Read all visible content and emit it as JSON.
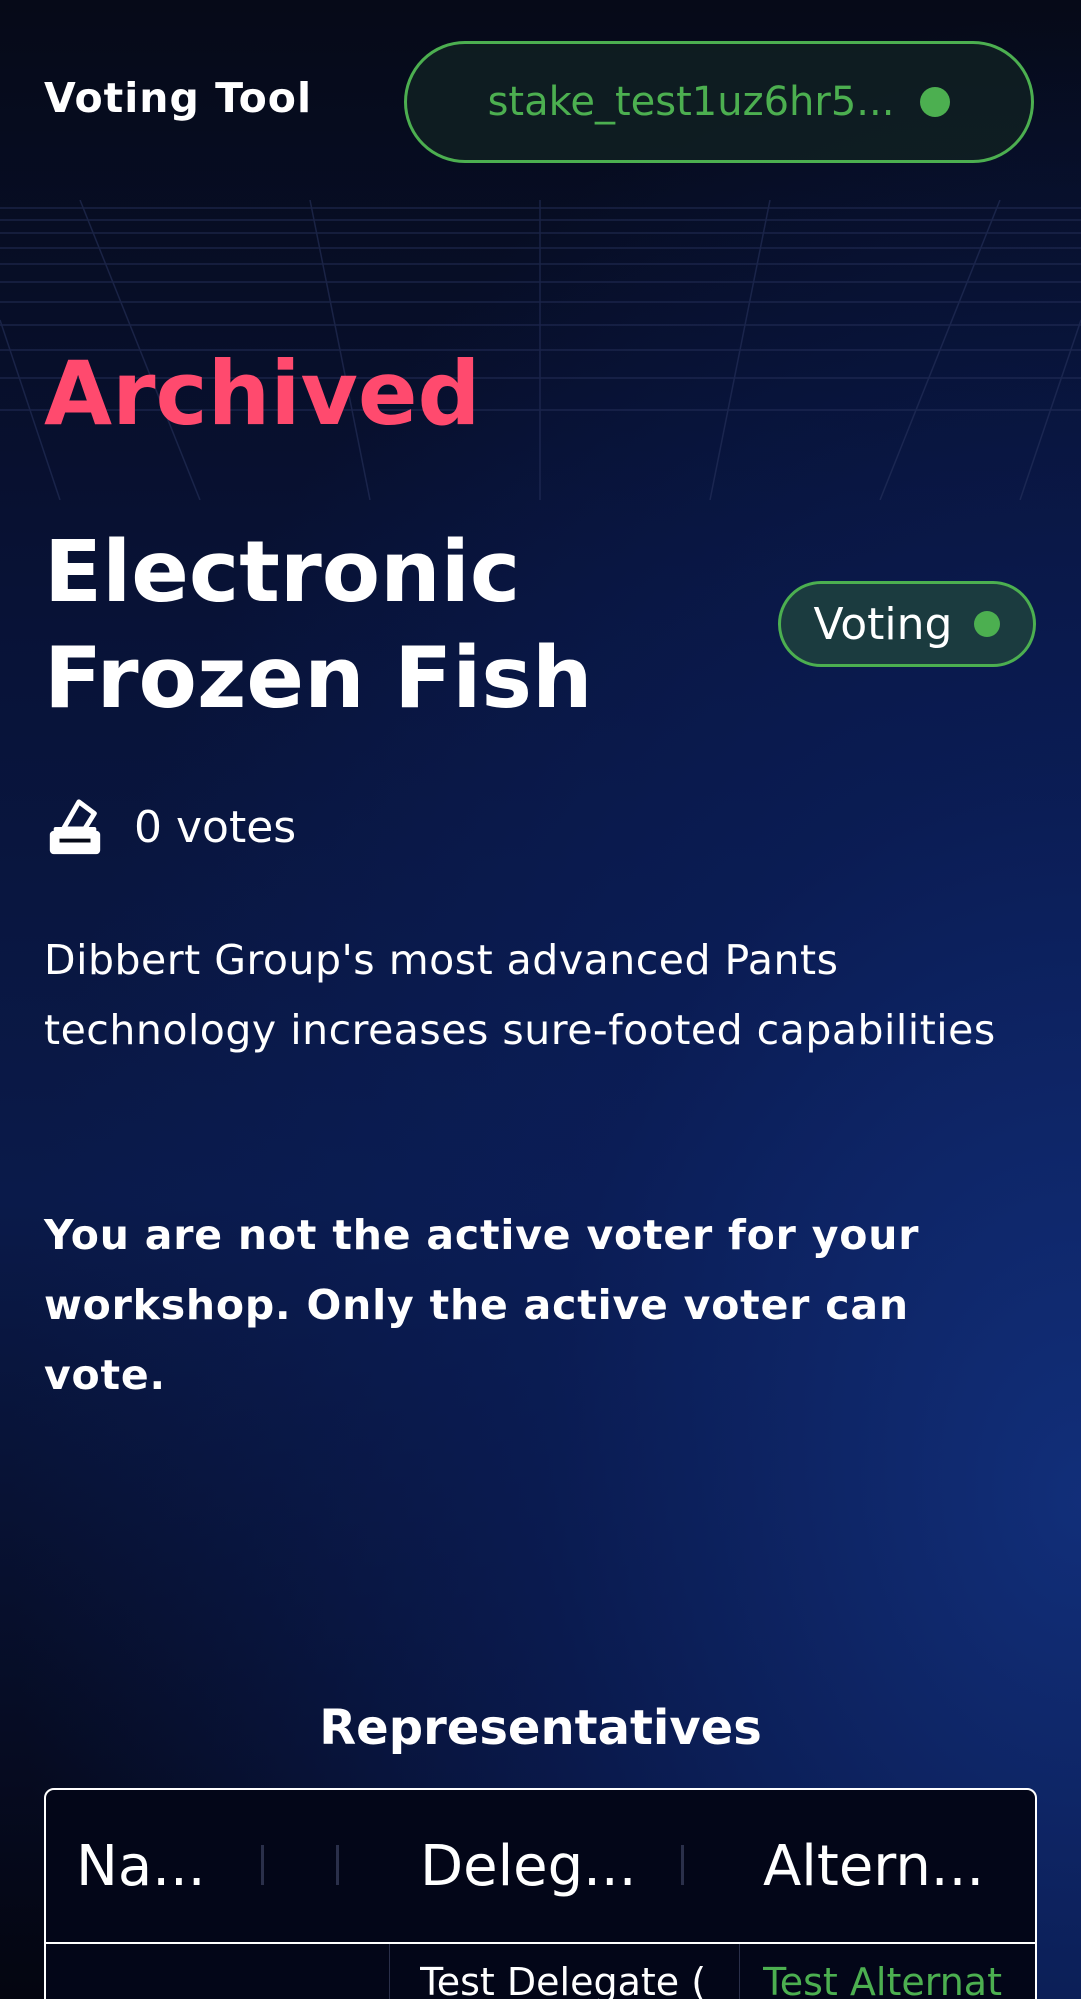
{
  "header": {
    "app_title": "Voting Tool",
    "wallet_label": "stake_test1uz6hr5...",
    "wallet_status_color": "#4caf50"
  },
  "proposal": {
    "status": "Archived",
    "title": "Electronic Frozen Fish",
    "badge_label": "Voting",
    "vote_count_label": "0 votes",
    "description": "Dibbert Group's most advanced Pants technology increases sure-footed capabilities",
    "notice": "You are not the active voter for your workshop. Only the active voter can vote."
  },
  "representatives": {
    "section_title": "Representatives",
    "columns": [
      "Na...",
      "Deleg...",
      "Altern..."
    ],
    "rows": [
      {
        "name": "",
        "delegate": "Test Delegate (",
        "alternate": "Test Alternat"
      }
    ]
  },
  "colors": {
    "accent_green": "#4caf50",
    "archived_red": "#ff4a6e",
    "background": "#050816"
  },
  "icons": {
    "ballot": "ballot-box-icon",
    "status": "status-dot-icon"
  }
}
